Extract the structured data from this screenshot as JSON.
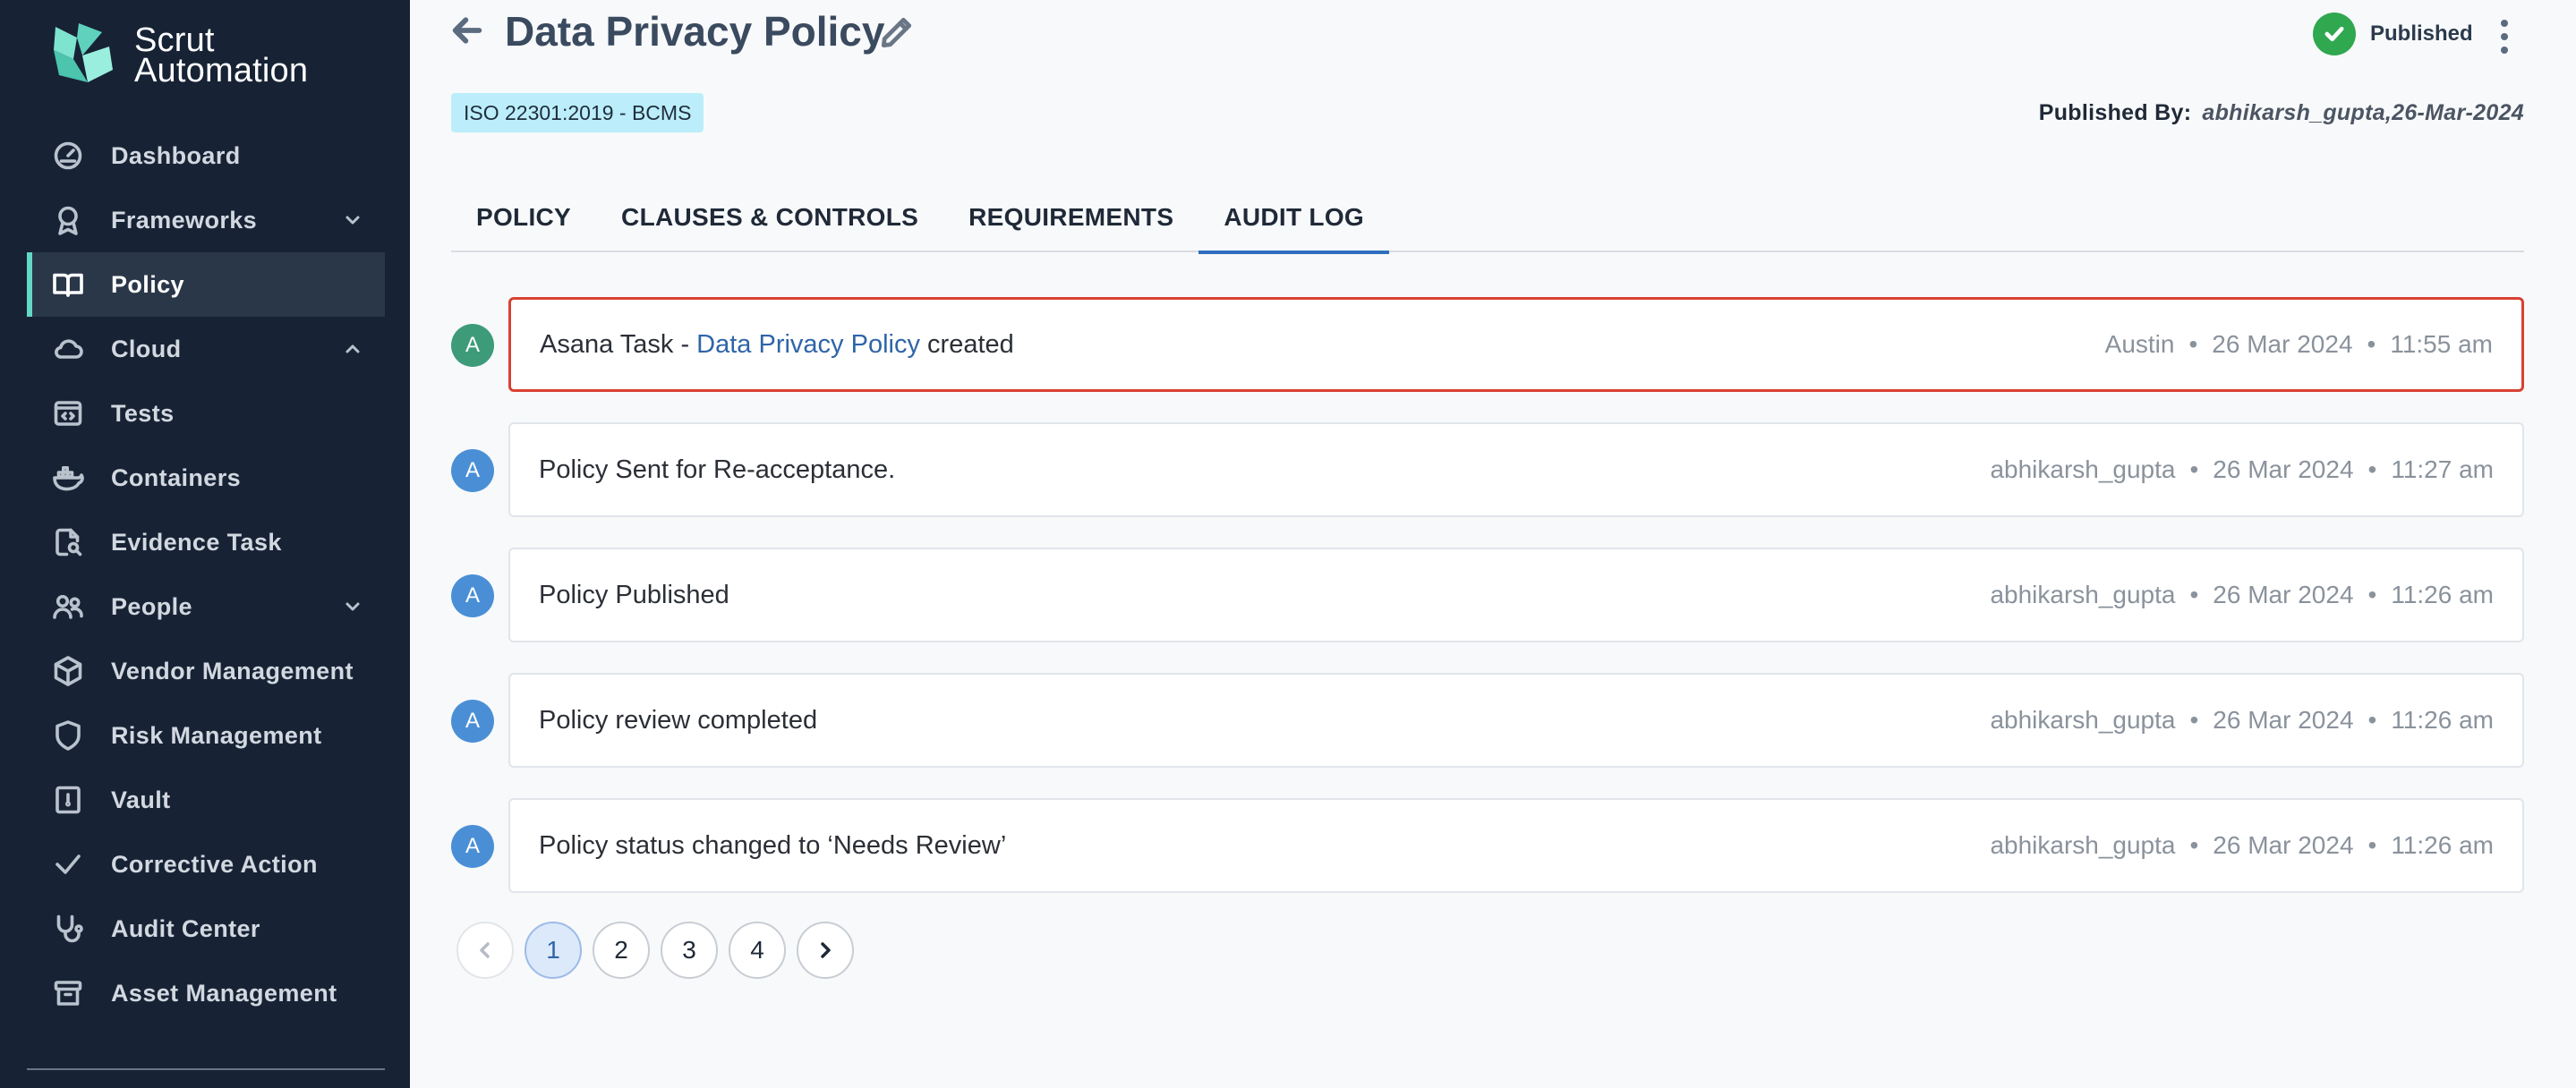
{
  "brand": {
    "line1": "Scrut",
    "line2": "Automation"
  },
  "colors": {
    "sidebar_bg": "#172335",
    "active_accent": "#63d8c4",
    "link": "#2f65a8",
    "status_green": "#2fa84f",
    "highlight": "#d94133"
  },
  "sidebar": {
    "items": [
      {
        "label": "Dashboard",
        "icon": "dashboard-gauge-icon"
      },
      {
        "label": "Frameworks",
        "icon": "award-ribbon-icon",
        "chevron": "chevron-down-icon"
      },
      {
        "label": "Policy",
        "icon": "open-book-icon",
        "active": true
      },
      {
        "label": "Cloud",
        "icon": "cloud-icon",
        "chevron": "chevron-up-icon"
      },
      {
        "label": "Tests",
        "icon": "code-window-icon"
      },
      {
        "label": "Containers",
        "icon": "docker-whale-icon"
      },
      {
        "label": "Evidence Task",
        "icon": "document-search-icon"
      },
      {
        "label": "People",
        "icon": "people-icon",
        "chevron": "chevron-down-icon"
      },
      {
        "label": "Vendor Management",
        "icon": "package-box-icon"
      },
      {
        "label": "Risk Management",
        "icon": "shield-icon"
      },
      {
        "label": "Vault",
        "icon": "vault-safe-icon"
      },
      {
        "label": "Corrective Action",
        "icon": "checkmark-icon"
      },
      {
        "label": "Audit Center",
        "icon": "stethoscope-icon"
      },
      {
        "label": "Asset Management",
        "icon": "archive-box-icon"
      }
    ]
  },
  "header": {
    "title": "Data Privacy Policy",
    "status": "Published",
    "tag": "ISO 22301:2019 - BCMS",
    "published_by_label": "Published By:",
    "published_by_value": "abhikarsh_gupta,26-Mar-2024"
  },
  "tabs": [
    {
      "label": "POLICY"
    },
    {
      "label": "CLAUSES & CONTROLS"
    },
    {
      "label": "REQUIREMENTS"
    },
    {
      "label": "AUDIT LOG",
      "active": true
    }
  ],
  "audit_log": [
    {
      "avatar": "A",
      "text_before": "Asana Task - ",
      "link": "Data Privacy Policy",
      "text_after": " created",
      "user": "Austin",
      "date": "26 Mar 2024",
      "time": "11:55 am",
      "highlight": true
    },
    {
      "avatar": "A",
      "text_before": "Policy Sent for Re-acceptance.",
      "link": "",
      "text_after": "",
      "user": "abhikarsh_gupta",
      "date": "26 Mar 2024",
      "time": "11:27 am"
    },
    {
      "avatar": "A",
      "text_before": "Policy Published",
      "link": "",
      "text_after": "",
      "user": "abhikarsh_gupta",
      "date": "26 Mar 2024",
      "time": "11:26 am"
    },
    {
      "avatar": "A",
      "text_before": "Policy review completed",
      "link": "",
      "text_after": "",
      "user": "abhikarsh_gupta",
      "date": "26 Mar 2024",
      "time": "11:26 am"
    },
    {
      "avatar": "A",
      "text_before": "Policy status changed to ‘Needs Review’",
      "link": "",
      "text_after": "",
      "user": "abhikarsh_gupta",
      "date": "26 Mar 2024",
      "time": "11:26 am"
    }
  ],
  "meta_separator": "•",
  "pagination": {
    "pages": [
      "1",
      "2",
      "3",
      "4"
    ],
    "current": "1"
  }
}
